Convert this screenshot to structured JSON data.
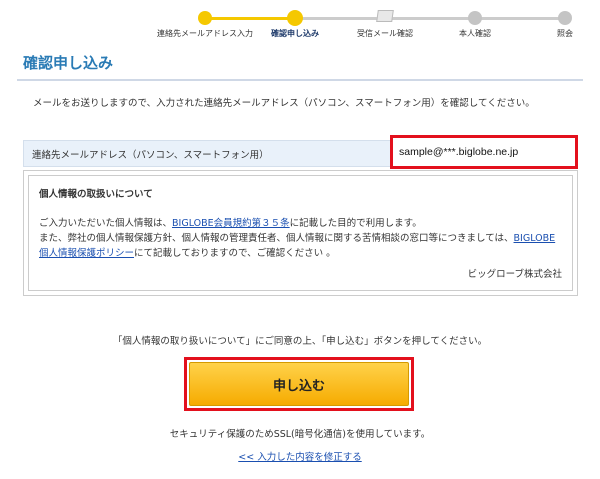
{
  "steps": [
    {
      "label": "連絡先メールアドレス入力",
      "state": "done"
    },
    {
      "label": "確認申し込み",
      "state": "current"
    },
    {
      "label": "受信メール確認",
      "state": "todo"
    },
    {
      "label": "本人確認",
      "state": "todo"
    },
    {
      "label": "照会",
      "state": "todo"
    }
  ],
  "title": "確認申し込み",
  "intro": "メールをお送りしますので、入力された連絡先メールアドレス（パソコン、スマートフォン用）を確認してください。",
  "email": {
    "label": "連絡先メールアドレス（パソコン、スマートフォン用）",
    "value": "sample@***.biglobe.ne.jp"
  },
  "privacy": {
    "heading": "個人情報の取扱いについて",
    "line1_pre": "ご入力いただいた個人情報は、",
    "line1_link": "BIGLOBE会員規約第３５条",
    "line1_post": "に記載した目的で利用します。",
    "line2": "また、弊社の個人情報保護方針、個人情報の管理責任者、個人情報に関する苦情相談の窓口等につきましては、",
    "line3_link": "BIGLOBE個人情報保護ポリシー",
    "line3_post": "にて記載しておりますので、ご確認ください 。",
    "company": "ビッグローブ株式会社"
  },
  "consent": "「個人情報の取り扱いについて」にご同意の上、「申し込む」ボタンを押してください。",
  "submit_label": "申し込む",
  "ssl_note": "セキュリティ保護のためSSL(暗号化通信)を使用しています。",
  "back_link": "<< 入力した内容を修正する",
  "colors": {
    "accent": "#2a7bb5",
    "progress_active": "#f5c800",
    "highlight_border": "#e3101d",
    "button": "#f6ab00"
  }
}
